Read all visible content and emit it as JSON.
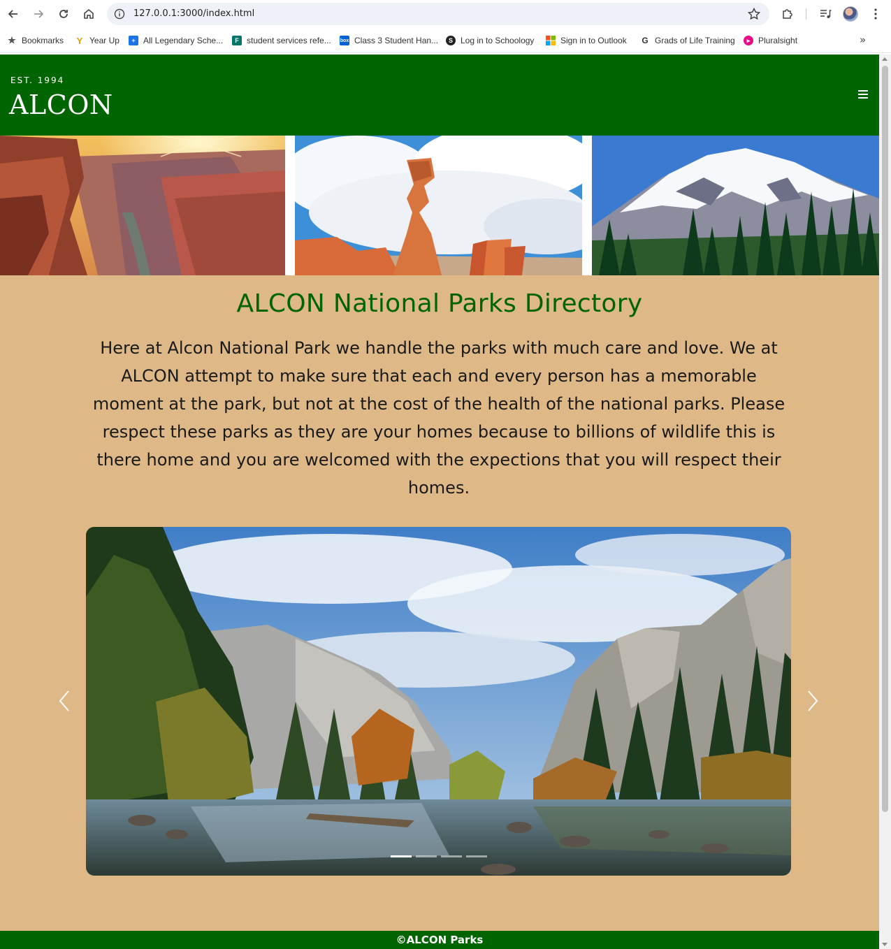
{
  "browser": {
    "url": "127.0.0.1:3000/index.html",
    "bookmarks": [
      {
        "label": "Bookmarks",
        "icon": "star-icon"
      },
      {
        "label": "Year Up",
        "icon": "yearup-icon"
      },
      {
        "label": "All Legendary Sche...",
        "icon": "calendar-icon"
      },
      {
        "label": "student services refe...",
        "icon": "forms-icon"
      },
      {
        "label": "Class 3 Student Han...",
        "icon": "box-icon"
      },
      {
        "label": "Log in to Schoology",
        "icon": "schoology-icon"
      },
      {
        "label": "Sign in to Outlook",
        "icon": "microsoft-icon"
      },
      {
        "label": "Grads of Life Training",
        "icon": "g-icon"
      },
      {
        "label": "Pluralsight",
        "icon": "pluralsight-icon"
      }
    ]
  },
  "header": {
    "est": "EST. 1994",
    "logo": "ALCON",
    "bg_color": "#006400"
  },
  "main": {
    "title": "ALCON National Parks Directory",
    "intro": "Here at Alcon National Park we handle the parks with much care and love. We at ALCON attempt to make sure that each and every person has a memorable moment at the park, but not at the cost of the health of the national parks. Please respect these parks as they are your homes because to billions of wildlife this is there home and you are welcomed with the expections that you will respect their homes.",
    "bg_color": "#deb887"
  },
  "carousel": {
    "slide_count": 4,
    "active_index": 0
  },
  "footer": {
    "text": "©ALCON Parks"
  }
}
